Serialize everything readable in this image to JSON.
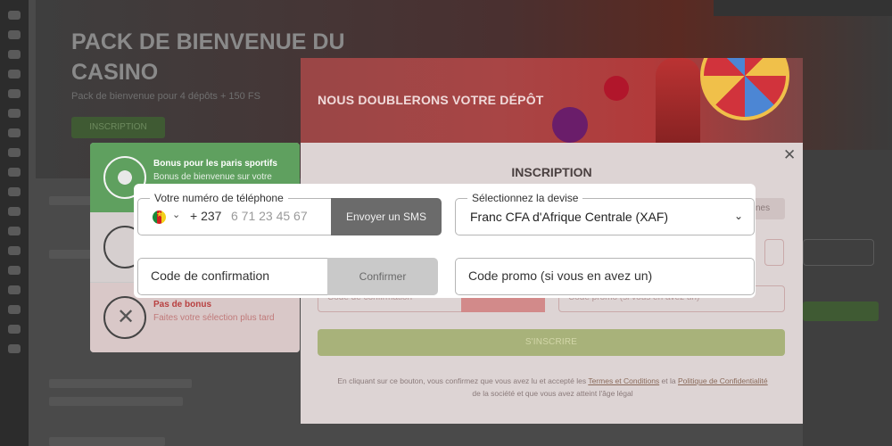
{
  "background": {
    "hero_title": "PACK DE BIENVENUE DU CASINO",
    "hero_subtitle": "Pack de bienvenue pour 4 dépôts + 150 FS",
    "hero_button": "INSCRIPTION"
  },
  "bonus_panel": {
    "items": [
      {
        "title": "Bonus pour les paris sportifs",
        "desc": "Bonus de bienvenue sur votre"
      },
      {
        "title": "",
        "desc": ""
      },
      {
        "title": "Pas de bonus",
        "desc": "Faites votre sélection plus tard"
      }
    ]
  },
  "modal": {
    "banner_title": "NOUS DOUBLERONS VOTRE DÉPÔT",
    "title": "INSCRIPTION",
    "close": "✕",
    "ghost_tab": "nes",
    "ghost_code": "Code de confirmation",
    "ghost_promo": "Code promo (si vous en avez un)",
    "submit": "S'INSCRIRE",
    "legal_1": "En cliquant sur ce bouton, vous confirmez que vous avez lu et accepté les",
    "legal_terms": "Termes et Conditions",
    "legal_2": "et la",
    "legal_privacy": "Politique de Confidentialité",
    "legal_3": "de la société et que vous avez atteint l'âge légal"
  },
  "form": {
    "phone_label": "Votre numéro de téléphone",
    "dial_code": "+ 237",
    "phone_placeholder": "6 71 23 45 67",
    "sms_button": "Envoyer un SMS",
    "currency_label": "Sélectionnez la devise",
    "currency_value": "Franc CFA d'Afrique Centrale (XAF)",
    "code_placeholder": "Code de confirmation",
    "confirm_button": "Confirmer",
    "promo_placeholder": "Code promo (si vous en avez un)"
  }
}
